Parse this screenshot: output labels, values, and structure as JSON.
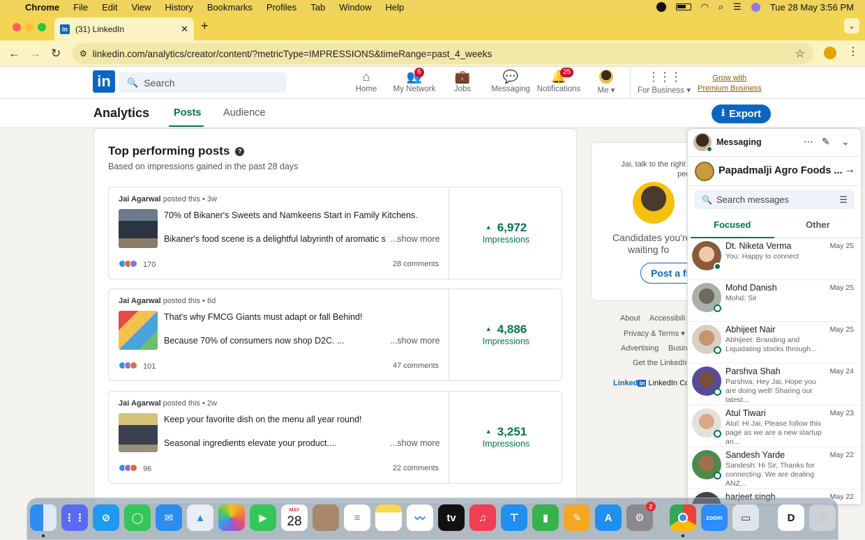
{
  "menubar": {
    "apple": "",
    "items": [
      "Chrome",
      "File",
      "Edit",
      "View",
      "History",
      "Bookmarks",
      "Profiles",
      "Tab",
      "Window",
      "Help"
    ],
    "datetime": "Tue 28 May  3:56 PM"
  },
  "browser": {
    "tab_title": "(31) LinkedIn",
    "tab_favicon": "in",
    "url": "linkedin.com/analytics/creator/content/?metricType=IMPRESSIONS&timeRange=past_4_weeks"
  },
  "linkedin": {
    "search_placeholder": "Search",
    "nav": [
      {
        "label": "Home",
        "icon": "home-icon",
        "badge": ""
      },
      {
        "label": "My Network",
        "icon": "people-icon",
        "badge": "6"
      },
      {
        "label": "Jobs",
        "icon": "briefcase-icon",
        "badge": ""
      },
      {
        "label": "Messaging",
        "icon": "chat-icon",
        "badge": ""
      },
      {
        "label": "Notifications",
        "icon": "bell-icon",
        "badge": "25"
      },
      {
        "label": "Me ▾",
        "icon": "avatar",
        "badge": ""
      }
    ],
    "for_business": "For Business ▾",
    "premium_line1": "Grow with",
    "premium_line2": "Premium Business"
  },
  "analytics": {
    "title": "Analytics",
    "tabs": [
      "Posts",
      "Audience"
    ],
    "export_label": "Export"
  },
  "main": {
    "title": "Top performing posts",
    "subtitle": "Based on impressions gained in the past 28 days",
    "posts": [
      {
        "author": "Jai Agarwal",
        "meta": " posted this • 3w",
        "headline": "70% of Bikaner's Sweets and Namkeens Start in Family Kitchens.",
        "body": "Bikaner's food scene is a delightful labyrinth of aromatic spices",
        "more": "...show more",
        "reactions": "170",
        "comments": "28 comments",
        "impressions": "6,972",
        "impressions_label": "Impressions"
      },
      {
        "author": "Jai Agarwal",
        "meta": " posted this • 6d",
        "headline": "That's why FMCG Giants must adapt or fall Behind!",
        "body": "Because 70% of consumers now shop D2C. ...",
        "more": "...show more",
        "reactions": "101",
        "comments": "47 comments",
        "impressions": "4,886",
        "impressions_label": "Impressions"
      },
      {
        "author": "Jai Agarwal",
        "meta": " posted this • 2w",
        "headline": "Keep your favorite dish on the menu all year round!",
        "body": "Seasonal ingredients elevate your product....",
        "more": "...show more",
        "reactions": "96",
        "comments": "22 comments",
        "impressions": "3,251",
        "impressions_label": "Impressions"
      }
    ]
  },
  "side": {
    "text_line1": "Jai, talk to the right pe",
    "text_line2": "peopl",
    "candidates_line1": "Candidates you're",
    "candidates_line2": "waiting fo",
    "button": "Post a fre",
    "footer": [
      "About",
      "Accessibili",
      "Privacy & Terms ▾",
      "Advertising",
      "Busin",
      "Get the LinkedIn"
    ],
    "corp_linked": "Linked",
    "corp_in": "in",
    "corp_text": "LinkedIn Co"
  },
  "messaging": {
    "title": "Messaging",
    "pinned": "Papadmalji Agro Foods ...",
    "search_placeholder": "Search messages",
    "tabs": [
      "Focused",
      "Other"
    ],
    "conversations": [
      {
        "name": "Dt. Niketa Verma",
        "date": "May 25",
        "preview": "You: Happy to connect",
        "color": "#c98a6a"
      },
      {
        "name": "Mohd Danish",
        "date": "May 25",
        "preview": "Mohd: Sir",
        "color": "#8c9490"
      },
      {
        "name": "Abhijeet Nair",
        "date": "May 25",
        "preview": "Abhijeet: Branding and Liquidating stocks through...",
        "color": "#b58e6c"
      },
      {
        "name": "Parshva Shah",
        "date": "May 24",
        "preview": "Parshva: Hey Jai, Hope you are doing well! Sharing our latest...",
        "color": "#4a3f7a"
      },
      {
        "name": "Atul Tiwari",
        "date": "May 23",
        "preview": "Atul: Hi Jai, Please follow this page as we are a new startup an...",
        "color": "#c9c4bd"
      },
      {
        "name": "Sandesh Yarde",
        "date": "May 22",
        "preview": "Sandesh: Hi Sir, Thanks for connecting. We are dealing ANZ...",
        "color": "#3f7a3a"
      },
      {
        "name": "harjeet singh",
        "date": "May 22",
        "preview": "",
        "color": "#555"
      }
    ]
  },
  "dock": {
    "calendar_month": "MAY",
    "calendar_day": "28",
    "settings_badge": "2",
    "zoom_label": "zoom"
  }
}
